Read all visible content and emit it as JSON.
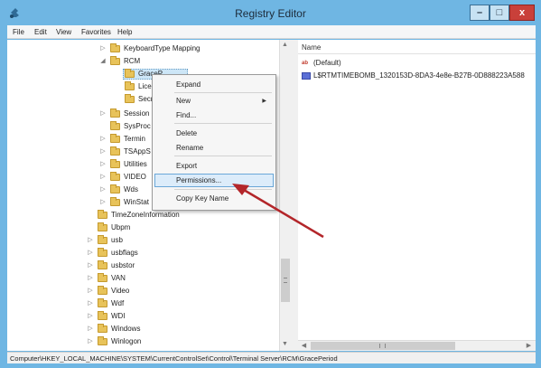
{
  "window": {
    "title": "Registry Editor",
    "minimize_label": "–",
    "maximize_label": "□",
    "close_label": "x"
  },
  "menu": [
    "File",
    "Edit",
    "View",
    "Favorites",
    "Help"
  ],
  "tree": {
    "items": [
      {
        "label": "KeyboardType Mapping",
        "expander": "▷"
      },
      {
        "label": "RCM",
        "expander": "◢"
      },
      {
        "label": "GraceP...",
        "expander": ""
      },
      {
        "label": "Lice",
        "expander": ""
      },
      {
        "label": "Secr",
        "expander": ""
      },
      {
        "label": "Session",
        "expander": "▷"
      },
      {
        "label": "SysProc",
        "expander": ""
      },
      {
        "label": "Termin",
        "expander": "▷"
      },
      {
        "label": "TSAppS",
        "expander": "▷"
      },
      {
        "label": "Utilities",
        "expander": "▷"
      },
      {
        "label": "VIDEO",
        "expander": "▷"
      },
      {
        "label": "Wds",
        "expander": "▷"
      },
      {
        "label": "WinStat",
        "expander": "▷"
      },
      {
        "label": "TimeZoneInformation",
        "expander": ""
      },
      {
        "label": "Ubpm",
        "expander": ""
      },
      {
        "label": "usb",
        "expander": "▷"
      },
      {
        "label": "usbflags",
        "expander": "▷"
      },
      {
        "label": "usbstor",
        "expander": "▷"
      },
      {
        "label": "VAN",
        "expander": "▷"
      },
      {
        "label": "Video",
        "expander": "▷"
      },
      {
        "label": "Wdf",
        "expander": "▷"
      },
      {
        "label": "WDI",
        "expander": "▷"
      },
      {
        "label": "Windows",
        "expander": "▷"
      },
      {
        "label": "Winlogon",
        "expander": "▷"
      }
    ]
  },
  "list": {
    "column_name": "Name",
    "rows": [
      {
        "icon": "string-value-icon",
        "glyph": "ab",
        "name": "(Default)"
      },
      {
        "icon": "binary-value-icon",
        "glyph": "",
        "name": "L$RTMTIMEBOMB_1320153D-8DA3-4e8e-B27B-0D888223A588"
      }
    ]
  },
  "context_menu": {
    "items": [
      {
        "label": "Expand"
      },
      {
        "label": "New",
        "submenu_arrow": "▶"
      },
      {
        "label": "Find..."
      },
      {
        "label": "Delete"
      },
      {
        "label": "Rename"
      },
      {
        "label": "Export"
      },
      {
        "label": "Permissions..."
      },
      {
        "label": "Copy Key Name"
      }
    ]
  },
  "scroll": {
    "up": "▲",
    "down": "▼",
    "left": "◀",
    "right": "▶"
  },
  "status": {
    "path": "Computer\\HKEY_LOCAL_MACHINE\\SYSTEM\\CurrentControlSet\\Control\\Terminal Server\\RCM\\GracePeriod"
  },
  "colors": {
    "titlebar": "#6fb6e3",
    "annotation_arrow": "#b3262a",
    "close_button": "#c9403a"
  }
}
